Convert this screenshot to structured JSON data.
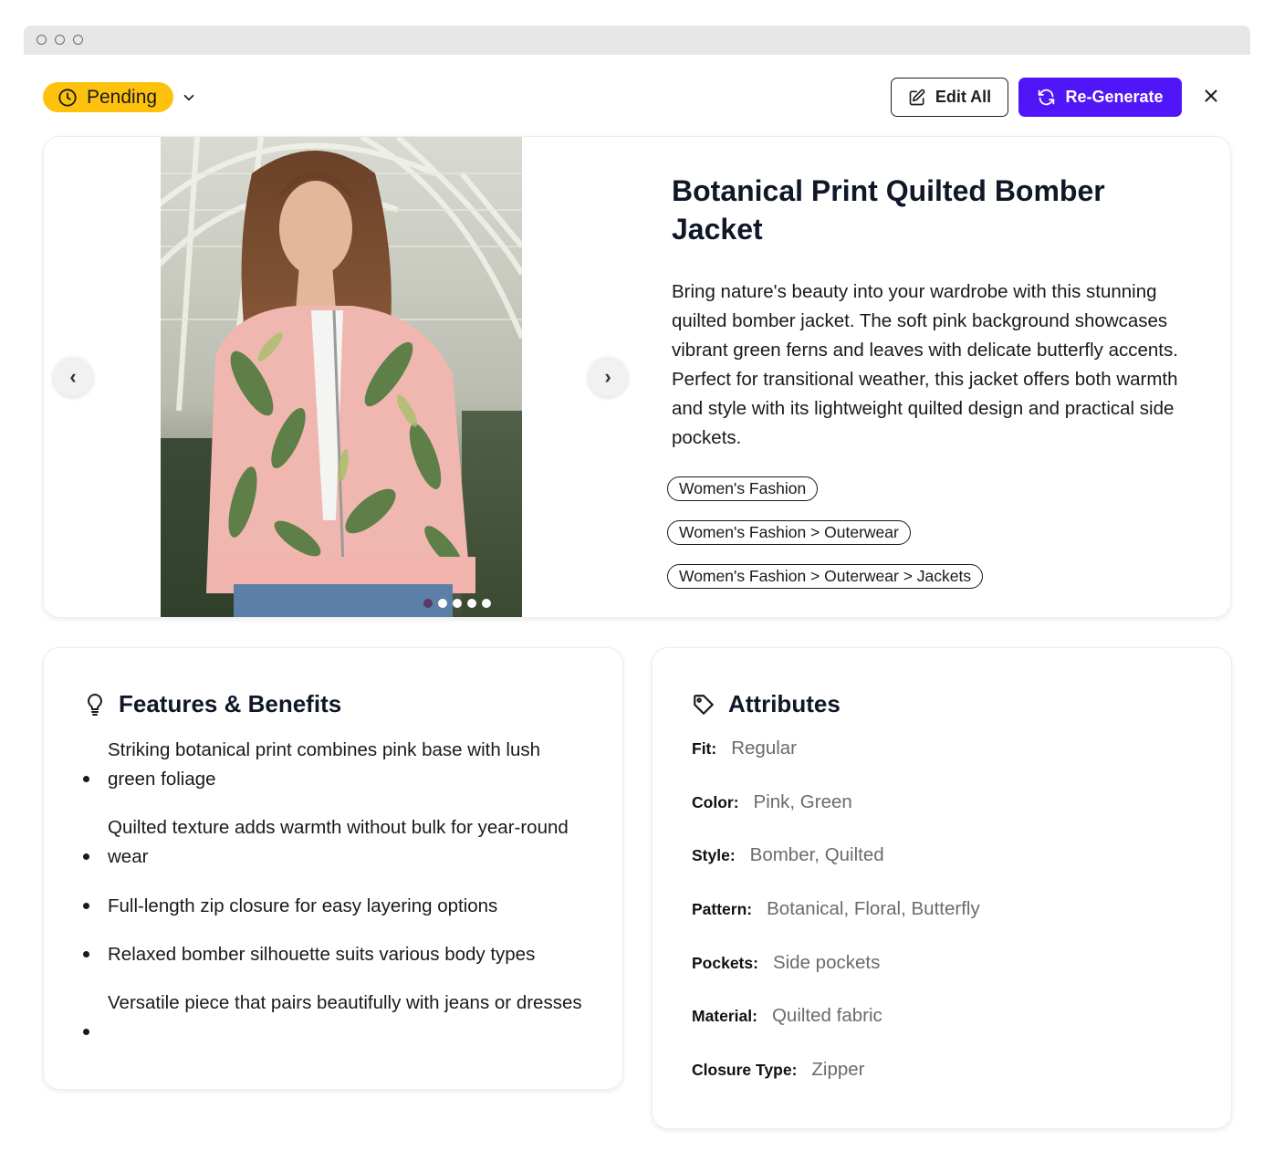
{
  "header": {
    "status": "Pending",
    "edit_label": "Edit All",
    "regenerate_label": "Re-Generate"
  },
  "product": {
    "title": "Botanical Print Quilted Bomber Jacket",
    "description": "Bring nature's beauty into your wardrobe with this stunning quilted bomber jacket. The soft pink background showcases vibrant green ferns and leaves with delicate butterfly accents. Perfect for transitional weather, this jacket offers both warmth and style with its lightweight quilted design and practical side pockets.",
    "categories": [
      "Women's Fashion",
      "Women's Fashion > Outerwear",
      "Women's Fashion > Outerwear > Jackets"
    ],
    "carousel": {
      "prev": "‹",
      "next": "›",
      "image_count": 5,
      "active_index": 0
    }
  },
  "features": {
    "title": "Features & Benefits",
    "items": [
      "Striking botanical print combines pink base with lush green foliage",
      "Quilted texture adds warmth without bulk for year-round wear",
      "Full-length zip closure for easy layering options",
      "Relaxed bomber silhouette suits various body types",
      "Versatile piece that pairs beautifully with jeans or dresses"
    ]
  },
  "attributes": {
    "title": "Attributes",
    "items": [
      {
        "key": "Fit:",
        "value": "Regular"
      },
      {
        "key": "Color:",
        "value": "Pink, Green"
      },
      {
        "key": "Style:",
        "value": "Bomber, Quilted"
      },
      {
        "key": "Pattern:",
        "value": "Botanical, Floral, Butterfly"
      },
      {
        "key": "Pockets:",
        "value": "Side pockets"
      },
      {
        "key": "Material:",
        "value": "Quilted fabric"
      },
      {
        "key": "Closure Type:",
        "value": "Zipper"
      }
    ]
  },
  "colors": {
    "status_yellow": "#fec20d",
    "primary_purple": "#5016f7",
    "jacket_pink": "#f0b7b0",
    "foliage_green": "#4f7a3c"
  },
  "icons": {
    "status": "clock-icon",
    "status_dropdown": "chevron-down-icon",
    "edit": "edit-icon",
    "regenerate": "refresh-icon",
    "close": "close-icon",
    "features": "lightbulb-icon",
    "attributes": "tag-icon"
  }
}
